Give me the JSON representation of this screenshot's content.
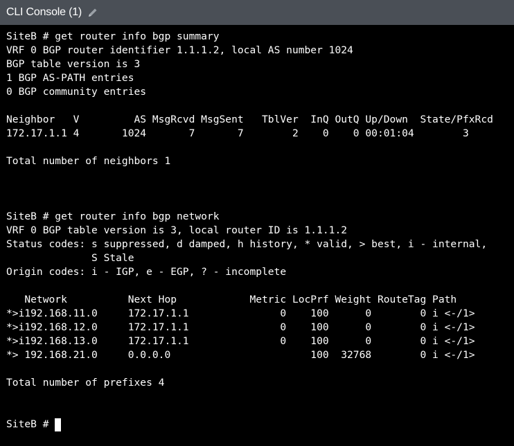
{
  "window": {
    "title": "CLI Console (1)",
    "edit_icon": "pencil-icon"
  },
  "terminal": {
    "lines": [
      "SiteB # get router info bgp summary",
      "VRF 0 BGP router identifier 1.1.1.2, local AS number 1024",
      "BGP table version is 3",
      "1 BGP AS-PATH entries",
      "0 BGP community entries",
      "",
      "Neighbor   V         AS MsgRcvd MsgSent   TblVer  InQ OutQ Up/Down  State/PfxRcd",
      "172.17.1.1 4       1024       7       7        2    0    0 00:01:04        3",
      "",
      "Total number of neighbors 1",
      "",
      "",
      "",
      "SiteB # get router info bgp network",
      "VRF 0 BGP table version is 3, local router ID is 1.1.1.2",
      "Status codes: s suppressed, d damped, h history, * valid, > best, i - internal,",
      "              S Stale",
      "Origin codes: i - IGP, e - EGP, ? - incomplete",
      "",
      "   Network          Next Hop            Metric LocPrf Weight RouteTag Path",
      "*>i192.168.11.0     172.17.1.1               0    100      0        0 i <-/1>",
      "*>i192.168.12.0     172.17.1.1               0    100      0        0 i <-/1>",
      "*>i192.168.13.0     172.17.1.1               0    100      0        0 i <-/1>",
      "*> 192.168.21.0     0.0.0.0                       100  32768        0 i <-/1>",
      "",
      "Total number of prefixes 4",
      "",
      ""
    ],
    "prompt": "SiteB # "
  },
  "colors": {
    "titlebar_bg": "#4a4f56",
    "terminal_bg": "#000000",
    "text": "#ffffff"
  }
}
